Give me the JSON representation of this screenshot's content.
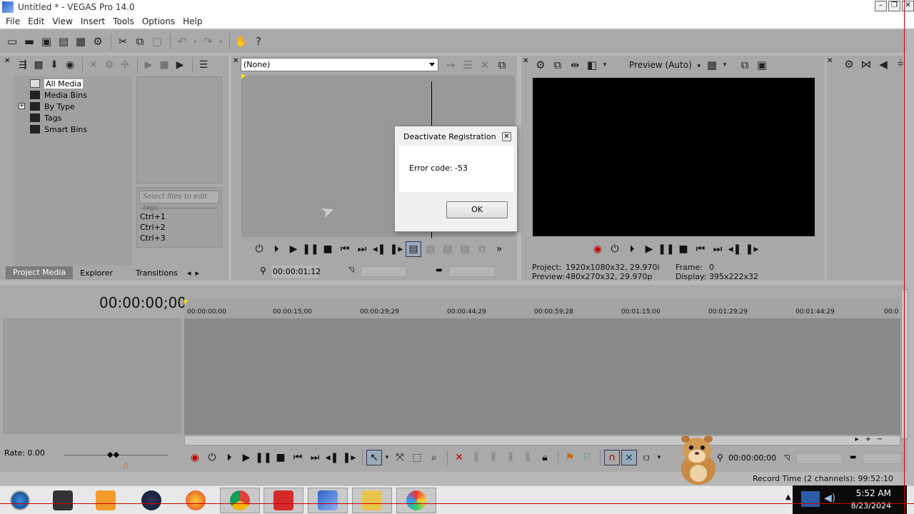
{
  "window": {
    "title": "Untitled * - VEGAS Pro 14.0"
  },
  "menu": [
    "File",
    "Edit",
    "View",
    "Insert",
    "Tools",
    "Options",
    "Help"
  ],
  "project_media": {
    "tree": [
      {
        "label": "All Media",
        "selected": true
      },
      {
        "label": "Media Bins"
      },
      {
        "label": "By Type",
        "expandable": true
      },
      {
        "label": "Tags"
      },
      {
        "label": "Smart Bins"
      }
    ],
    "tag_placeholder": "Select files to edit tags",
    "shortcuts": [
      "Ctrl+1",
      "Ctrl+2",
      "Ctrl+3"
    ],
    "tabs": [
      "Project Media",
      "Explorer",
      "Transitions"
    ]
  },
  "trimmer": {
    "selection": "(None)",
    "time": "00:00:01;12"
  },
  "preview": {
    "mode": "Preview (Auto)",
    "project_label": "Project:",
    "project_value": "1920x1080x32, 29.970i",
    "preview_label": "Preview:",
    "preview_value": "480x270x32, 29.970p",
    "frame_label": "Frame:",
    "frame_value": "0",
    "display_label": "Display:",
    "display_value": "395x222x32"
  },
  "timeline": {
    "current_time": "00:00:00;00",
    "ruler": [
      "00:00:00;00",
      "00:00:15;00",
      "00:00:29;29",
      "00:00:44;29",
      "00:00:59;28",
      "00:01:15;00",
      "00:01:29;29",
      "00:01:44;29",
      "00:0"
    ],
    "rate": "Rate: 0.00",
    "end_time": "00:00:00;00",
    "record_time": "Record Time (2 channels): 99:52:10"
  },
  "dialog": {
    "title": "Deactivate Registration",
    "message": "Error code: -53",
    "ok": "OK"
  },
  "taskbar": {
    "clock": "5:52 AM",
    "date": "8/23/2024"
  },
  "colors": {
    "accent": "#2a60c8",
    "video_bg": "#000000",
    "tray_bg": "#0a0a0a"
  }
}
